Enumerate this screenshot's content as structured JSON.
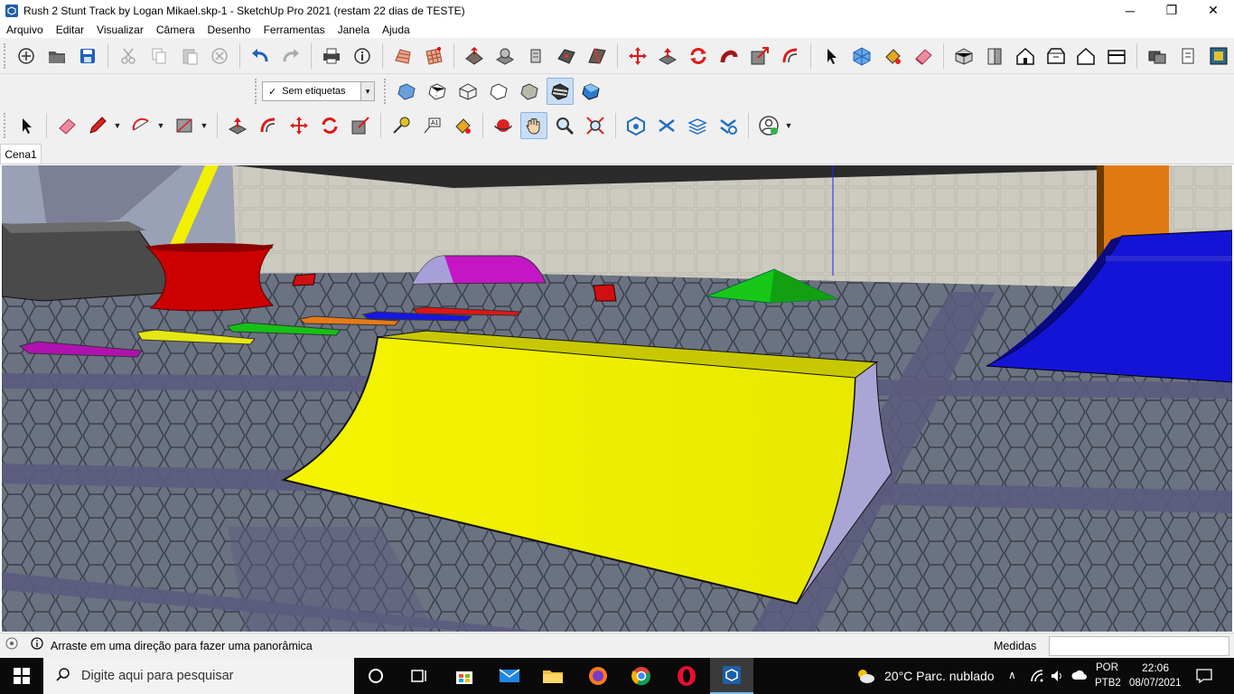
{
  "window": {
    "title": "Rush 2 Stunt Track by Logan Mikael.skp-1 - SketchUp Pro 2021 (restam 22 dias de TESTE)",
    "minimize": "─",
    "restore": "❐",
    "close": "✕"
  },
  "menu": [
    "Arquivo",
    "Editar",
    "Visualizar",
    "Câmera",
    "Desenho",
    "Ferramentas",
    "Janela",
    "Ajuda"
  ],
  "tags_toolbar": {
    "selected": "Sem etiquetas",
    "check": "✓"
  },
  "scenes": {
    "active": "Cena1"
  },
  "status": {
    "message": "Arraste em uma direção para fazer uma panorâmica",
    "measures_label": "Medidas",
    "measures_value": ""
  },
  "taskbar": {
    "search_placeholder": "Digite aqui para pesquisar",
    "weather": "20°C  Parc. nublado",
    "lang_top": "POR",
    "lang_bottom": "PTB2",
    "time": "22:06",
    "date": "08/07/2021"
  },
  "colors": {
    "toolbar_bg": "#f0f0f0",
    "taskbar_bg": "#0a0a0a",
    "active_tool": "#c9def5",
    "ramp_yellow": "#f2f200",
    "ramp_blue": "#1414d6"
  },
  "viewport": {
    "scene": "3D model of a stunt track: tiled floor with hexagon pattern, yellow quarter-pipe ramp, blue ramp, red spool, purple and green bumps, colored flat pads"
  }
}
